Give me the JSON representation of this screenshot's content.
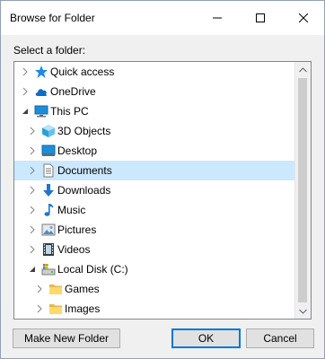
{
  "window": {
    "title": "Browse for Folder"
  },
  "dialog": {
    "prompt": "Select a folder:"
  },
  "tree": {
    "items": [
      {
        "label": "Quick access",
        "icon": "star-icon",
        "expander": "collapsed"
      },
      {
        "label": "OneDrive",
        "icon": "cloud-icon",
        "expander": "collapsed"
      },
      {
        "label": "This PC",
        "icon": "computer-icon",
        "expander": "expanded"
      },
      {
        "label": "3D Objects",
        "icon": "cube-icon",
        "expander": "collapsed"
      },
      {
        "label": "Desktop",
        "icon": "desktop-icon",
        "expander": "collapsed"
      },
      {
        "label": "Documents",
        "icon": "document-icon",
        "expander": "collapsed",
        "selected": true
      },
      {
        "label": "Downloads",
        "icon": "download-icon",
        "expander": "collapsed"
      },
      {
        "label": "Music",
        "icon": "music-icon",
        "expander": "collapsed"
      },
      {
        "label": "Pictures",
        "icon": "picture-icon",
        "expander": "collapsed"
      },
      {
        "label": "Videos",
        "icon": "video-icon",
        "expander": "collapsed"
      },
      {
        "label": "Local Disk (C:)",
        "icon": "drive-icon",
        "expander": "expanded"
      },
      {
        "label": "Games",
        "icon": "folder-icon",
        "expander": "collapsed"
      },
      {
        "label": "Images",
        "icon": "folder-icon",
        "expander": "collapsed"
      }
    ]
  },
  "buttons": {
    "new_folder": "Make New Folder",
    "ok": "OK",
    "cancel": "Cancel"
  },
  "colors": {
    "selection": "#cce8ff",
    "accent": "#0078d7"
  }
}
